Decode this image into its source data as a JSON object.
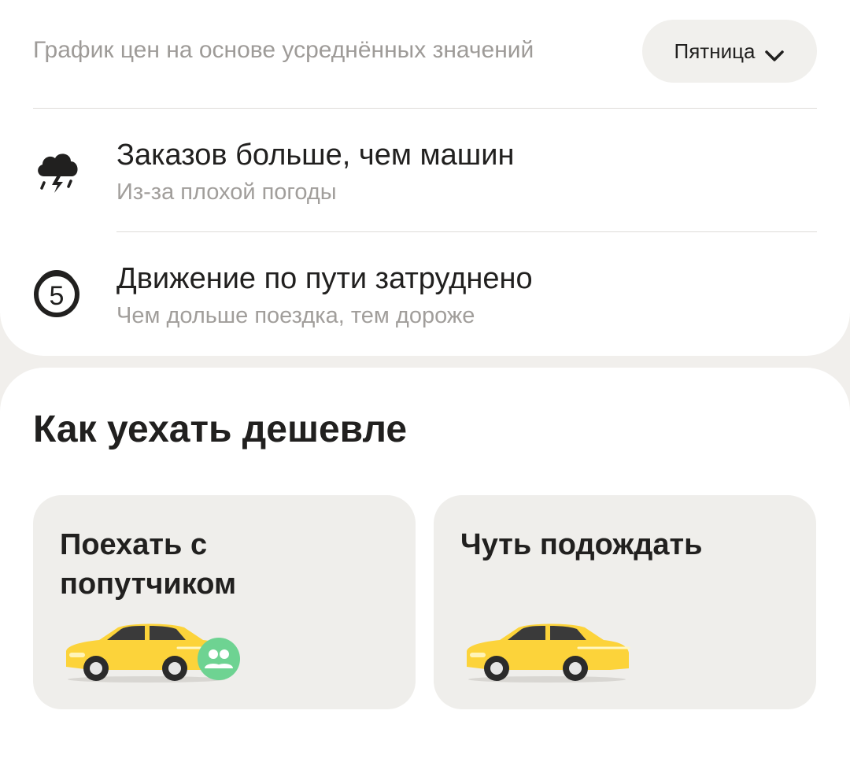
{
  "price_chart": {
    "caption": "График цен на основе усреднённых значений",
    "day_selected": "Пятница"
  },
  "factors": [
    {
      "icon": "storm-cloud-icon",
      "title": "Заказов больше, чем машин",
      "subtitle": "Из-за плохой погоды"
    },
    {
      "icon": "traffic-level-icon",
      "badge": "5",
      "title": "Движение по пути затруднено",
      "subtitle": "Чем дольше поездка, тем дороже"
    }
  ],
  "cheaper": {
    "title": "Как уехать дешевле",
    "options": [
      {
        "label": "Поехать с\nпопутчиком",
        "icon": "taxi-car-with-fellow-travelers"
      },
      {
        "label": "Чуть подождать",
        "icon": "taxi-car"
      }
    ]
  },
  "colors": {
    "taxi_yellow": "#fcd33a",
    "badge_green": "#6ed392",
    "muted_text": "#a19e9b"
  }
}
